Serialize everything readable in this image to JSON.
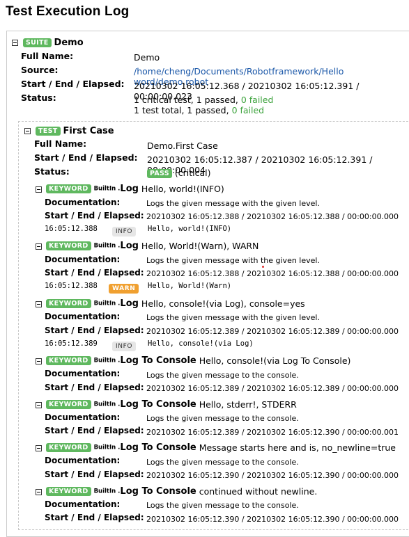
{
  "page_title": "Test Execution Log",
  "suite": {
    "badge": "SUITE",
    "name": "Demo",
    "full_name_label": "Full Name:",
    "full_name": "Demo",
    "source_label": "Source:",
    "source": "/home/cheng/Documents/Robotframework/Hello word/demo.robot",
    "times_label": "Start / End / Elapsed:",
    "times": "20210302 16:05:12.368 / 20210302 16:05:12.391 / 00:00:00.023",
    "status_label": "Status:",
    "status_line1_prefix": "1 critical test, 1 passed, ",
    "status_line1_failed": "0 failed",
    "status_line2_prefix": "1 test total, 1 passed, ",
    "status_line2_failed": "0 failed"
  },
  "test": {
    "badge": "TEST",
    "name": "First Case",
    "full_name_label": "Full Name:",
    "full_name": "Demo.First Case",
    "times_label": "Start / End / Elapsed:",
    "times": "20210302 16:05:12.387 / 20210302 16:05:12.391 / 00:00:00.004",
    "status_label": "Status:",
    "status_badge": "PASS",
    "status_note": "(critical)"
  },
  "keywords": [
    {
      "badge": "KEYWORD",
      "lib": "BuiltIn .",
      "name": "Log",
      "args": "Hello, world!(INFO)",
      "doc_label": "Documentation:",
      "doc": "Logs the given message with the given level.",
      "times_label": "Start / End / Elapsed:",
      "times": "20210302 16:05:12.388 / 20210302 16:05:12.388 / 00:00:00.000",
      "msg_time": "16:05:12.388",
      "msg_level": "INFO",
      "msg_text": "Hello, world!(INFO)"
    },
    {
      "badge": "KEYWORD",
      "lib": "BuiltIn .",
      "name": "Log",
      "args": "Hello, World!(Warn), WARN",
      "doc_label": "Documentation:",
      "doc": "Logs the given message with the given level.",
      "times_label": "Start / End / Elapsed:",
      "times": "20210302 16:05:12.388 / 20210302 16:05:12.388 / 00:00:00.000",
      "msg_time": "16:05:12.388",
      "msg_level": "WARN",
      "msg_text": "Hello, World!(Warn)"
    },
    {
      "badge": "KEYWORD",
      "lib": "BuiltIn .",
      "name": "Log",
      "args": "Hello, console!(via Log), console=yes",
      "doc_label": "Documentation:",
      "doc": "Logs the given message with the given level.",
      "times_label": "Start / End / Elapsed:",
      "times": "20210302 16:05:12.389 / 20210302 16:05:12.389 / 00:00:00.000",
      "msg_time": "16:05:12.389",
      "msg_level": "INFO",
      "msg_text": "Hello, console!(via Log)"
    },
    {
      "badge": "KEYWORD",
      "lib": "BuiltIn .",
      "name": "Log To Console",
      "args": "Hello, console!(via Log To Console)",
      "doc_label": "Documentation:",
      "doc": "Logs the given message to the console.",
      "times_label": "Start / End / Elapsed:",
      "times": "20210302 16:05:12.389 / 20210302 16:05:12.389 / 00:00:00.000"
    },
    {
      "badge": "KEYWORD",
      "lib": "BuiltIn .",
      "name": "Log To Console",
      "args": "Hello, stderr!, STDERR",
      "doc_label": "Documentation:",
      "doc": "Logs the given message to the console.",
      "times_label": "Start / End / Elapsed:",
      "times": "20210302 16:05:12.389 / 20210302 16:05:12.390 / 00:00:00.001"
    },
    {
      "badge": "KEYWORD",
      "lib": "BuiltIn .",
      "name": "Log To Console",
      "args": "Message starts here and is, no_newline=true",
      "doc_label": "Documentation:",
      "doc": "Logs the given message to the console.",
      "times_label": "Start / End / Elapsed:",
      "times": "20210302 16:05:12.390 / 20210302 16:05:12.390 / 00:00:00.000"
    },
    {
      "badge": "KEYWORD",
      "lib": "BuiltIn .",
      "name": "Log To Console",
      "args": "continued without newline.",
      "doc_label": "Documentation:",
      "doc": "Logs the given message to the console.",
      "times_label": "Start / End / Elapsed:",
      "times": "20210302 16:05:12.390 / 20210302 16:05:12.390 / 00:00:00.000"
    }
  ],
  "colors": {
    "badge_green": "#5fb85f",
    "warn_orange": "#f0a030",
    "link_blue": "#1a57a8",
    "failed_green": "#3ea33e"
  }
}
